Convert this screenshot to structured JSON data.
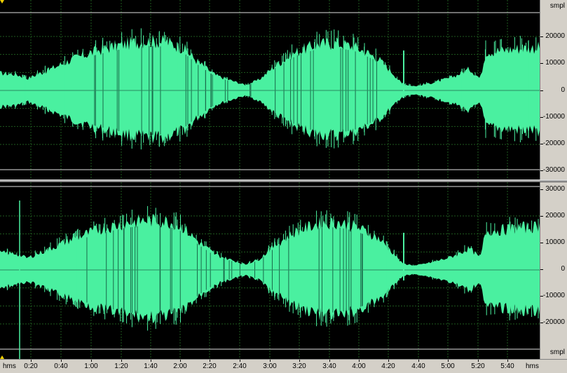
{
  "colors": {
    "waveform": "#4af0a0",
    "background": "#000000",
    "grid": "#1e5a1e",
    "clip_line": "#e0e0e0",
    "marker": "#f0d000"
  },
  "vertical_scale": {
    "unit": "smpl",
    "channel1_labels": [
      "20000",
      "10000",
      "0",
      "-10000",
      "-20000",
      "-30000"
    ],
    "channel2_labels": [
      "30000",
      "20000",
      "10000",
      "0",
      "-10000",
      "-20000"
    ]
  },
  "timeline": {
    "unit_left": "hms",
    "unit_right": "hms",
    "labels": [
      "0:20",
      "0:40",
      "1:00",
      "1:20",
      "1:40",
      "2:00",
      "2:20",
      "2:40",
      "3:00",
      "3:20",
      "3:40",
      "4:00",
      "4:20",
      "4:40",
      "5:00",
      "5:20",
      "5:40"
    ]
  }
}
